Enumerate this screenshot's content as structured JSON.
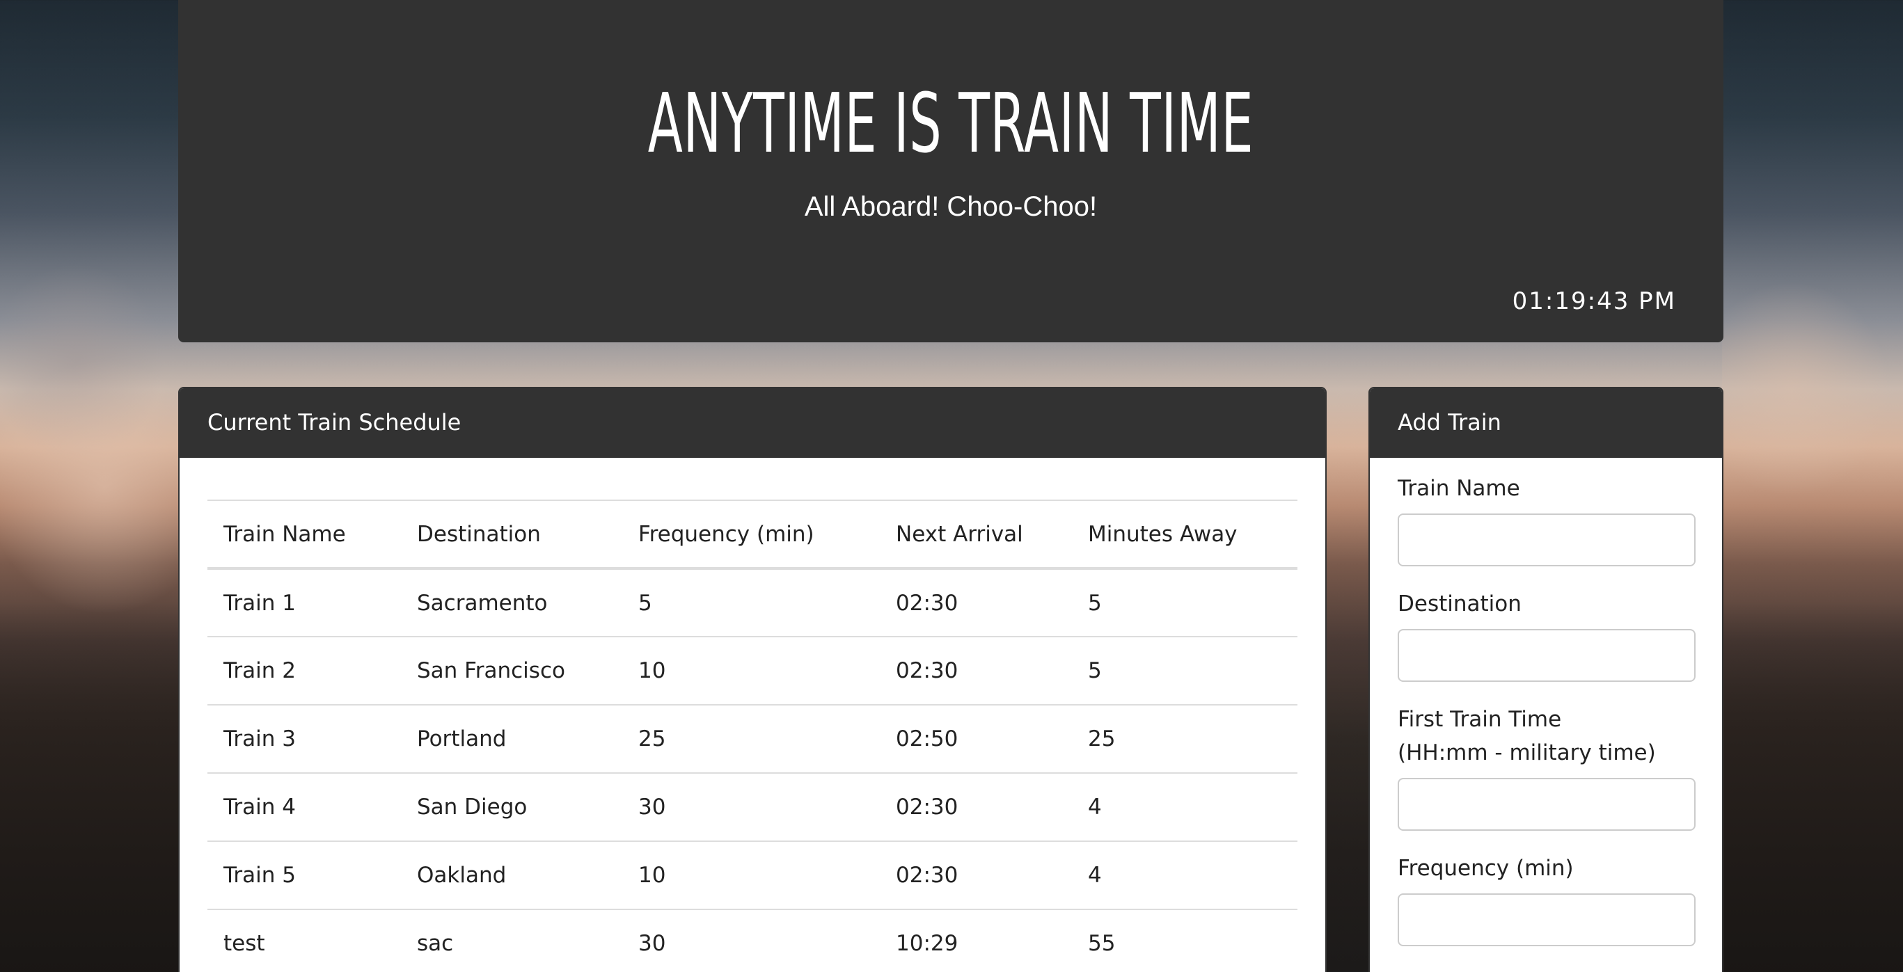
{
  "header": {
    "title": "ANYTIME IS TRAIN TIME",
    "subtitle": "All Aboard! Choo-Choo!",
    "clock": "01:19:43 PM"
  },
  "schedule": {
    "heading": "Current Train Schedule",
    "columns": [
      "Train Name",
      "Destination",
      "Frequency (min)",
      "Next Arrival",
      "Minutes Away"
    ],
    "rows": [
      [
        "Train 1",
        "Sacramento",
        "5",
        "02:30",
        "5"
      ],
      [
        "Train 2",
        "San Francisco",
        "10",
        "02:30",
        "5"
      ],
      [
        "Train 3",
        "Portland",
        "25",
        "02:50",
        "25"
      ],
      [
        "Train 4",
        "San Diego",
        "30",
        "02:30",
        "4"
      ],
      [
        "Train 5",
        "Oakland",
        "10",
        "02:30",
        "4"
      ],
      [
        "test",
        "sac",
        "30",
        "10:29",
        "55"
      ]
    ]
  },
  "add_train": {
    "heading": "Add Train",
    "fields": [
      {
        "label": "Train Name",
        "value": ""
      },
      {
        "label": "Destination",
        "value": ""
      },
      {
        "label_line1": "First Train Time",
        "label_line2": "(HH:mm - military time)",
        "value": ""
      },
      {
        "label": "Frequency (min)",
        "value": ""
      }
    ]
  }
}
